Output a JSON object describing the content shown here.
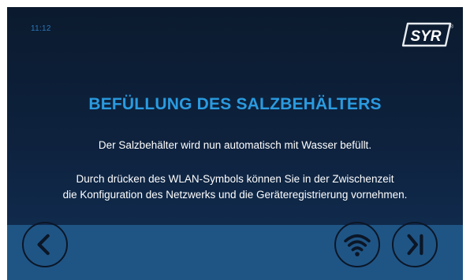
{
  "status": {
    "time": "11:12"
  },
  "brand": {
    "logo_text": "SYR",
    "registered_mark": "®"
  },
  "main": {
    "title": "BEFÜLLUNG DES SALZBEHÄLTERS",
    "line1": "Der Salzbehälter wird nun automatisch mit Wasser befüllt.",
    "para_line1": "Durch drücken des WLAN-Symbols können Sie in der Zwischenzeit",
    "para_line2": "die Konfiguration des Netzwerks und die Geräteregistrierung vornehmen."
  },
  "footer": {
    "buttons": [
      {
        "icon": "back-arrow-icon"
      },
      {
        "icon": "wifi-icon"
      },
      {
        "icon": "skip-icon"
      }
    ]
  },
  "colors": {
    "background": "#0e2340",
    "title": "#2a9be0",
    "footer": "#1f5585",
    "button_stroke": "#0b1626"
  }
}
